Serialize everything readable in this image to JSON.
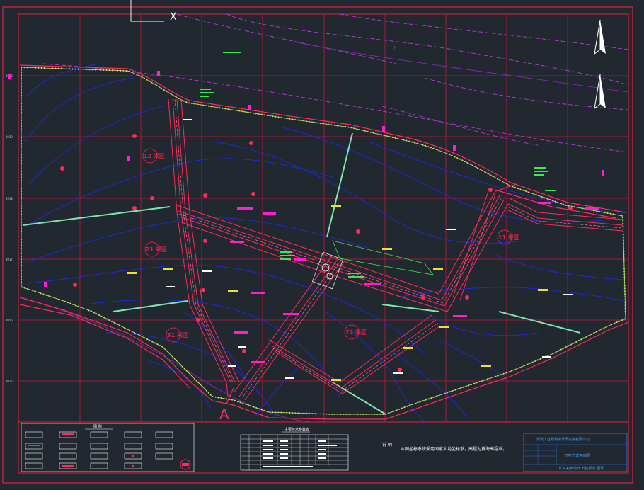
{
  "drawing": {
    "pad_labels": [
      "12 采区",
      "21 采区",
      "31 采区",
      "22 采区",
      "11 采区"
    ],
    "north_arrow": "north-arrow-icon",
    "portal_mark": "A",
    "corner_mark": "X",
    "question_marks": [
      "?",
      "?"
    ]
  },
  "legend": {
    "title": "图 例"
  },
  "table": {
    "title": "主要技术参数表"
  },
  "notes": {
    "label": "说 明：",
    "text": "本图坐标系统采用国家大地坐标系，高程为黄海高程系。"
  },
  "title_block": {
    "company": "煤炭工业规划设计研究院有限公司",
    "drawing_name": "开拓方式平面图",
    "footer": "矿井初步设计 开拓部分 图号"
  },
  "colors": {
    "background": "#212830",
    "grid": "#d81b3c",
    "boundary": "#c8e86a",
    "roadway": "#ff2a5a",
    "contour": "#1f2bd8",
    "road": "#c23bd8",
    "annotation": "#3de84a"
  }
}
